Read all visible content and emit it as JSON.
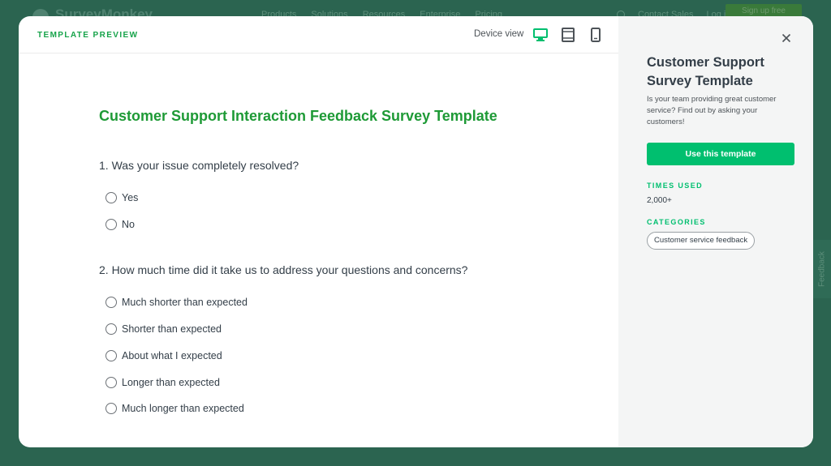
{
  "background": {
    "brand": "SurveyMonkey",
    "nav": [
      "Products",
      "Solutions",
      "Resources",
      "Enterprise",
      "Pricing"
    ],
    "contact_sales": "Contact Sales",
    "login": "Log in",
    "signup": "Sign up free",
    "feedback_tab": "Feedback"
  },
  "modal": {
    "header_label": "TEMPLATE PREVIEW",
    "device_view_label": "Device view",
    "device_icons": [
      "desktop-icon",
      "tablet-icon",
      "mobile-icon"
    ],
    "active_device": "desktop"
  },
  "survey": {
    "title": "Customer Support Interaction Feedback Survey Template",
    "questions": [
      {
        "text": "1. Was your issue completely resolved?",
        "options": [
          "Yes",
          "No"
        ]
      },
      {
        "text": "2. How much time did it take us to address your questions and concerns?",
        "options": [
          "Much shorter than expected",
          "Shorter than expected",
          "About what I expected",
          "Longer than expected",
          "Much longer than expected"
        ]
      }
    ]
  },
  "sidebar": {
    "title": "Customer Support Survey Template",
    "description": "Is your team providing great customer service? Find out by asking your customers!",
    "use_button": "Use this template",
    "times_used_heading": "TIMES USED",
    "times_used_value": "2,000+",
    "categories_heading": "CATEGORIES",
    "categories": [
      "Customer service feedback"
    ]
  },
  "colors": {
    "accent": "#00bf6f",
    "title_green": "#1e9a36",
    "overlay": "#2b6450"
  }
}
